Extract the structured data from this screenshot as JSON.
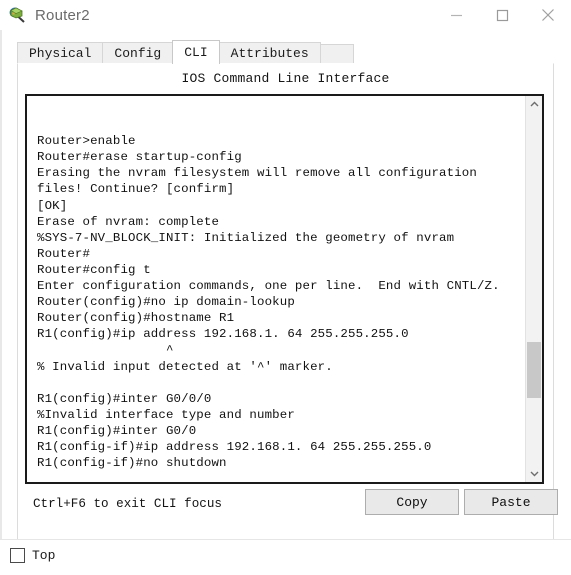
{
  "window": {
    "title": "Router2",
    "icon": "router-device-icon",
    "controls": [
      {
        "name": "minimize-button",
        "glyph": "minimize-icon"
      },
      {
        "name": "maximize-button",
        "glyph": "maximize-icon"
      },
      {
        "name": "close-button",
        "glyph": "close-icon"
      }
    ]
  },
  "tabs": [
    {
      "label": "Physical",
      "active": false
    },
    {
      "label": "Config",
      "active": false
    },
    {
      "label": "CLI",
      "active": true
    },
    {
      "label": "Attributes",
      "active": false
    }
  ],
  "panel": {
    "title": "IOS Command Line Interface"
  },
  "console": {
    "text": "\n\nRouter>enable\nRouter#erase startup-config\nErasing the nvram filesystem will remove all configuration\nfiles! Continue? [confirm]\n[OK]\nErase of nvram: complete\n%SYS-7-NV_BLOCK_INIT: Initialized the geometry of nvram\nRouter#\nRouter#config t\nEnter configuration commands, one per line.  End with CNTL/Z.\nRouter(config)#no ip domain-lookup\nRouter(config)#hostname R1\nR1(config)#ip address 192.168.1. 64 255.255.255.0\n                 ^\n% Invalid input detected at '^' marker.\n\nR1(config)#inter G0/0/0\n%Invalid interface type and number\nR1(config)#inter G0/0\nR1(config-if)#ip address 192.168.1. 64 255.255.255.0\nR1(config-if)#no shutdown",
    "scrollbar": {
      "up_arrow": "chevron-up-icon",
      "down_arrow": "chevron-down-icon"
    }
  },
  "footer": {
    "hint": "Ctrl+F6 to exit CLI focus",
    "copy_label": "Copy",
    "paste_label": "Paste"
  },
  "bottom": {
    "top_checkbox_label": "Top",
    "top_checked": false
  },
  "colors": {
    "window_bg": "#ffffff",
    "tab_inactive": "#f0f0f0",
    "tab_active": "#ffffff",
    "console_border": "#1a1a1a",
    "console_text": "#111111",
    "button_face": "#e9e9e9",
    "scroll_thumb": "#c8c8c8",
    "title_text": "#6b6b6b"
  }
}
